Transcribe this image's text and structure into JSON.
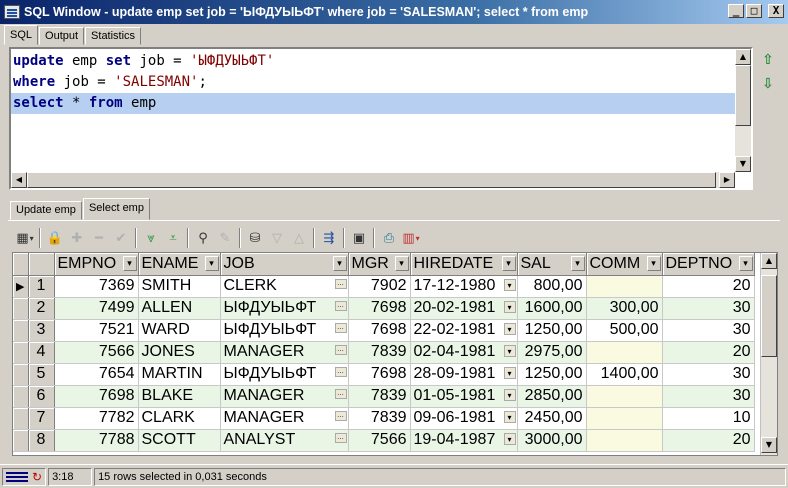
{
  "window": {
    "title": "SQL Window - update emp set job = 'ЫФДУЫЬФТ' where job = 'SALESMAN'; select * from emp",
    "buttons": [
      "_",
      "□",
      "X"
    ]
  },
  "top_tabs": [
    "SQL",
    "Output",
    "Statistics"
  ],
  "editor": {
    "line1": {
      "kw1": "update",
      "t1": " emp ",
      "kw2": "set",
      "t2": " job = ",
      "str": "'ЫФДУЫЬФТ'"
    },
    "line2": {
      "kw1": "where",
      "t1": " job = ",
      "str": "'SALESMAN'",
      "t2": ";"
    },
    "line3": {
      "kw1": "select",
      "t1": " * ",
      "kw2": "from",
      "t2": " emp"
    }
  },
  "result_tabs": [
    "Update emp",
    "Select emp"
  ],
  "toolbar_icons": [
    "grid-view-icon",
    "lock-icon",
    "insert-record-icon",
    "delete-record-icon",
    "post-changes-icon",
    "fetch-next-icon",
    "fetch-last-icon",
    "find-icon",
    "clear-icon",
    "query-by-example-icon",
    "previous-icon",
    "next-icon",
    "export-icon",
    "save-icon",
    "print-icon",
    "chart-icon"
  ],
  "grid": {
    "columns": [
      "EMPNO",
      "ENAME",
      "JOB",
      "MGR",
      "HIREDATE",
      "SAL",
      "COMM",
      "DEPTNO"
    ],
    "rows": [
      {
        "no": "1",
        "empno": "7369",
        "ename": "SMITH",
        "job": "CLERK",
        "mgr": "7902",
        "hiredate": "17-12-1980",
        "sal": "800,00",
        "comm": "",
        "deptno": "20"
      },
      {
        "no": "2",
        "empno": "7499",
        "ename": "ALLEN",
        "job": "ЫФДУЫЬФТ",
        "mgr": "7698",
        "hiredate": "20-02-1981",
        "sal": "1600,00",
        "comm": "300,00",
        "deptno": "30"
      },
      {
        "no": "3",
        "empno": "7521",
        "ename": "WARD",
        "job": "ЫФДУЫЬФТ",
        "mgr": "7698",
        "hiredate": "22-02-1981",
        "sal": "1250,00",
        "comm": "500,00",
        "deptno": "30"
      },
      {
        "no": "4",
        "empno": "7566",
        "ename": "JONES",
        "job": "MANAGER",
        "mgr": "7839",
        "hiredate": "02-04-1981",
        "sal": "2975,00",
        "comm": "",
        "deptno": "20"
      },
      {
        "no": "5",
        "empno": "7654",
        "ename": "MARTIN",
        "job": "ЫФДУЫЬФТ",
        "mgr": "7698",
        "hiredate": "28-09-1981",
        "sal": "1250,00",
        "comm": "1400,00",
        "deptno": "30"
      },
      {
        "no": "6",
        "empno": "7698",
        "ename": "BLAKE",
        "job": "MANAGER",
        "mgr": "7839",
        "hiredate": "01-05-1981",
        "sal": "2850,00",
        "comm": "",
        "deptno": "30"
      },
      {
        "no": "7",
        "empno": "7782",
        "ename": "CLARK",
        "job": "MANAGER",
        "mgr": "7839",
        "hiredate": "09-06-1981",
        "sal": "2450,00",
        "comm": "",
        "deptno": "10"
      },
      {
        "no": "8",
        "empno": "7788",
        "ename": "SCOTT",
        "job": "ANALYST",
        "mgr": "7566",
        "hiredate": "19-04-1987",
        "sal": "3000,00",
        "comm": "",
        "deptno": "20"
      }
    ],
    "cell_button": "...",
    "row_indicator": "▶"
  },
  "status": {
    "position": "3:18",
    "message": "15 rows selected in 0,031 seconds"
  },
  "colors": {
    "title_start": "#0a246a",
    "title_end": "#a6caf0",
    "selection": "#b7cff0",
    "alt_row": "#e9f6e6"
  }
}
